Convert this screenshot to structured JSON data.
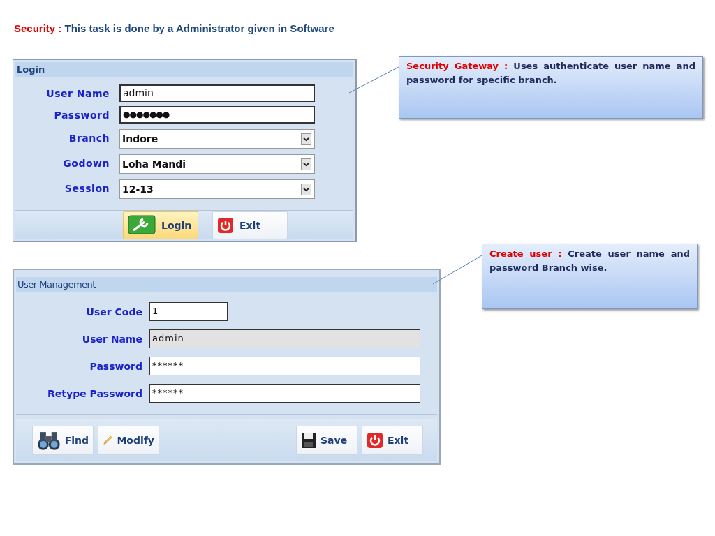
{
  "heading": {
    "label": "Security :",
    "text": "This task is done by a Administrator given in Software"
  },
  "login_window": {
    "title": "Login",
    "fields": [
      {
        "label": "User Name",
        "value": "admin",
        "kind": "text"
      },
      {
        "label": "Password",
        "value": "●●●●●●●",
        "kind": "password"
      },
      {
        "label": "Branch",
        "value": "Indore",
        "kind": "select"
      },
      {
        "label": "Godown",
        "value": "Loha Mandi",
        "kind": "select"
      },
      {
        "label": "Session",
        "value": "12-13",
        "kind": "select"
      }
    ],
    "buttons": [
      {
        "label": "Login",
        "kind": "login",
        "highlighted": true
      },
      {
        "label": "Exit",
        "kind": "exit",
        "highlighted": false
      }
    ]
  },
  "user_management_window": {
    "title": "User Management",
    "fields": [
      {
        "label": "User Code",
        "value": "1",
        "kind": "short"
      },
      {
        "label": "User Name",
        "value": "admin",
        "kind": "readonly"
      },
      {
        "label": "Password",
        "value": "******",
        "kind": "text"
      },
      {
        "label": "Retype Password",
        "value": "******",
        "kind": "text"
      }
    ],
    "buttons_left": [
      {
        "label": "Find",
        "kind": "find"
      },
      {
        "label": "Modify",
        "kind": "modify"
      }
    ],
    "buttons_right": [
      {
        "label": "Save",
        "kind": "save"
      },
      {
        "label": "Exit",
        "kind": "exit"
      }
    ]
  },
  "callouts": [
    {
      "label": "Security Gateway :",
      "text": "Uses  authenticate user name  and password for specific branch."
    },
    {
      "label": "Create user  :",
      "text": "Create user name and password Branch wise."
    }
  ]
}
